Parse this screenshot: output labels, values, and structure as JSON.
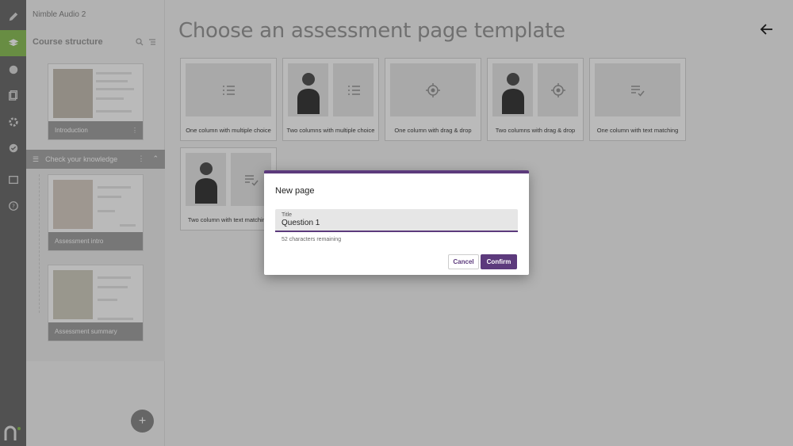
{
  "panel": {
    "project_name": "Nimble Audio 2",
    "title": "Course structure",
    "pages": [
      {
        "label": "Introduction"
      },
      {
        "label": "Assessment intro"
      },
      {
        "label": "Assessment summary"
      }
    ],
    "section": {
      "label": "Check your knowledge"
    },
    "add_button": "+"
  },
  "main": {
    "title": "Choose an assessment page template",
    "templates": [
      {
        "label": "One column with multiple choice",
        "icon": "list-icon"
      },
      {
        "label": "Two columns with multiple choice",
        "icon": "list-icon"
      },
      {
        "label": "One column with drag & drop",
        "icon": "target-icon"
      },
      {
        "label": "Two columns with drag & drop",
        "icon": "target-icon"
      },
      {
        "label": "One column with text matching",
        "icon": "text-check-icon"
      },
      {
        "label": "Two column with text matching",
        "icon": "text-check-icon"
      }
    ]
  },
  "modal": {
    "title": "New page",
    "field_label": "Title",
    "field_value": "Question 1",
    "helper": "52 characters remaining",
    "cancel_label": "Cancel",
    "confirm_label": "Confirm"
  },
  "colors": {
    "accent": "#5c3a7c",
    "rail": "#6f6f6f",
    "rail_active": "#8fc25c"
  }
}
